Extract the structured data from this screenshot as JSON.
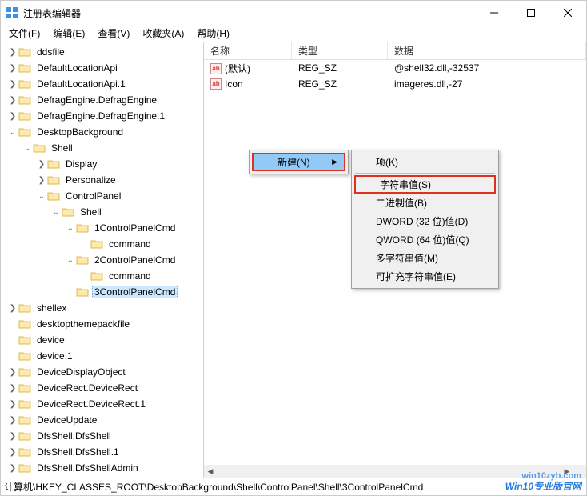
{
  "window": {
    "title": "注册表编辑器"
  },
  "menu": {
    "file": "文件(F)",
    "edit": "编辑(E)",
    "view": "查看(V)",
    "favorites": "收藏夹(A)",
    "help": "帮助(H)"
  },
  "tree": [
    {
      "indent": 0,
      "exp": ">",
      "label": "ddsfile"
    },
    {
      "indent": 0,
      "exp": ">",
      "label": "DefaultLocationApi"
    },
    {
      "indent": 0,
      "exp": ">",
      "label": "DefaultLocationApi.1"
    },
    {
      "indent": 0,
      "exp": ">",
      "label": "DefragEngine.DefragEngine"
    },
    {
      "indent": 0,
      "exp": ">",
      "label": "DefragEngine.DefragEngine.1"
    },
    {
      "indent": 0,
      "exp": "v",
      "label": "DesktopBackground"
    },
    {
      "indent": 1,
      "exp": "v",
      "label": "Shell"
    },
    {
      "indent": 2,
      "exp": ">",
      "label": "Display"
    },
    {
      "indent": 2,
      "exp": ">",
      "label": "Personalize"
    },
    {
      "indent": 2,
      "exp": "v",
      "label": "ControlPanel"
    },
    {
      "indent": 3,
      "exp": "v",
      "label": "Shell"
    },
    {
      "indent": 4,
      "exp": "v",
      "label": "1ControlPanelCmd"
    },
    {
      "indent": 5,
      "exp": "",
      "label": "command"
    },
    {
      "indent": 4,
      "exp": "v",
      "label": "2ControlPanelCmd"
    },
    {
      "indent": 5,
      "exp": "",
      "label": "command"
    },
    {
      "indent": 4,
      "exp": "",
      "label": "3ControlPanelCmd",
      "selected": true
    },
    {
      "indent": 0,
      "exp": ">",
      "label": "shellex"
    },
    {
      "indent": 0,
      "exp": "",
      "label": "desktopthemepackfile"
    },
    {
      "indent": 0,
      "exp": "",
      "label": "device"
    },
    {
      "indent": 0,
      "exp": "",
      "label": "device.1"
    },
    {
      "indent": 0,
      "exp": ">",
      "label": "DeviceDisplayObject"
    },
    {
      "indent": 0,
      "exp": ">",
      "label": "DeviceRect.DeviceRect"
    },
    {
      "indent": 0,
      "exp": ">",
      "label": "DeviceRect.DeviceRect.1"
    },
    {
      "indent": 0,
      "exp": ">",
      "label": "DeviceUpdate"
    },
    {
      "indent": 0,
      "exp": ">",
      "label": "DfsShell.DfsShell"
    },
    {
      "indent": 0,
      "exp": ">",
      "label": "DfsShell.DfsShell.1"
    },
    {
      "indent": 0,
      "exp": ">",
      "label": "DfsShell.DfsShellAdmin"
    }
  ],
  "columns": {
    "name": "名称",
    "type": "类型",
    "data": "数据"
  },
  "values": [
    {
      "name": "(默认)",
      "type": "REG_SZ",
      "data": "@shell32.dll,-32537"
    },
    {
      "name": "Icon",
      "type": "REG_SZ",
      "data": "imageres.dll,-27"
    }
  ],
  "contextMenu": {
    "new": "新建(N)",
    "sub": {
      "key": "项(K)",
      "string": "字符串值(S)",
      "binary": "二进制值(B)",
      "dword": "DWORD (32 位)值(D)",
      "qword": "QWORD (64 位)值(Q)",
      "multi": "多字符串值(M)",
      "expand": "可扩充字符串值(E)"
    }
  },
  "statusbar": "计算机\\HKEY_CLASSES_ROOT\\DesktopBackground\\Shell\\ControlPanel\\Shell\\3ControlPanelCmd",
  "watermark": {
    "url": "win10zyb.com",
    "text": "Win10专业版官网"
  }
}
